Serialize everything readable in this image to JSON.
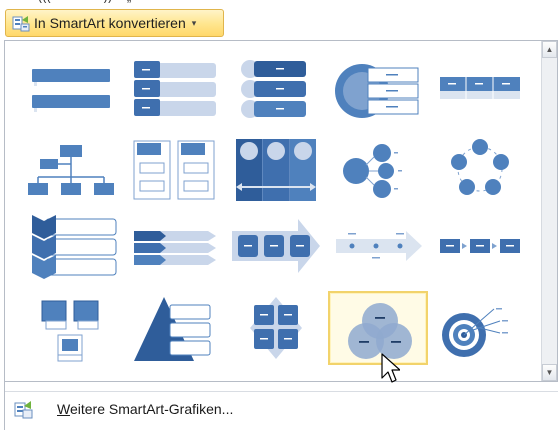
{
  "top_partial_text": "((( ~ ~~ ~~ )) ~ „ ~ ~ ~",
  "convert_button": {
    "label": "In SmartArt konvertieren",
    "caret": "▾"
  },
  "gallery": {
    "layouts": [
      {
        "icon": "stacked-list-icon"
      },
      {
        "icon": "horizontal-bullet-list-icon"
      },
      {
        "icon": "stacked-rounded-list-icon"
      },
      {
        "icon": "radial-table-list-icon"
      },
      {
        "icon": "table-list-icon"
      },
      {
        "icon": "organization-chart-icon"
      },
      {
        "icon": "vertical-box-list-icon"
      },
      {
        "icon": "vertical-circle-list-icon"
      },
      {
        "icon": "hub-and-spoke-icon"
      },
      {
        "icon": "cycle-icon"
      },
      {
        "icon": "chevron-list-icon"
      },
      {
        "icon": "vertical-chevron-list-icon"
      },
      {
        "icon": "arrow-process-icon"
      },
      {
        "icon": "timeline-arrow-icon"
      },
      {
        "icon": "basic-process-icon"
      },
      {
        "icon": "bending-picture-icon"
      },
      {
        "icon": "pyramid-list-icon"
      },
      {
        "icon": "matrix-icon"
      },
      {
        "icon": "venn-diagram-icon"
      },
      {
        "icon": "target-icon"
      }
    ],
    "selected_index": 18
  },
  "more_button": {
    "label_underlined": "W",
    "label_rest": "eitere SmartArt-Grafiken..."
  },
  "colors": {
    "accent": "#4f81bd",
    "dark": "#2f5d9a",
    "light": "#dbe4f0",
    "hover_border": "#f2d36b",
    "button_fill": "#ffe58d"
  }
}
